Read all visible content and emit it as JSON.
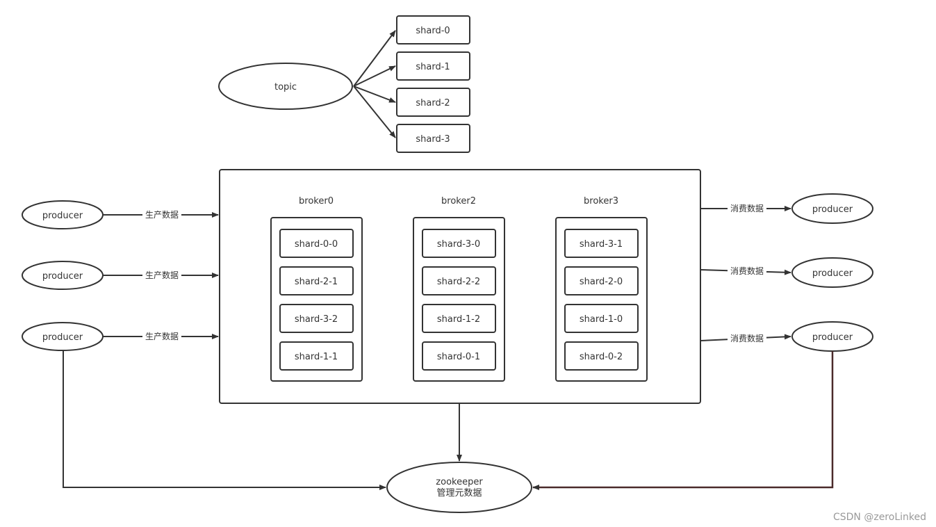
{
  "topic": {
    "label": "topic",
    "shards": [
      "shard-0",
      "shard-1",
      "shard-2",
      "shard-3"
    ]
  },
  "brokers": [
    {
      "name": "broker0",
      "shards": [
        "shard-0-0",
        "shard-2-1",
        "shard-3-2",
        "shard-1-1"
      ]
    },
    {
      "name": "broker2",
      "shards": [
        "shard-3-0",
        "shard-2-2",
        "shard-1-2",
        "shard-0-1"
      ]
    },
    {
      "name": "broker3",
      "shards": [
        "shard-3-1",
        "shard-2-0",
        "shard-1-0",
        "shard-0-2"
      ]
    }
  ],
  "left_producers": [
    {
      "label": "producer",
      "edge": "生产数据"
    },
    {
      "label": "producer",
      "edge": "生产数据"
    },
    {
      "label": "producer",
      "edge": "生产数据"
    }
  ],
  "right_producers": [
    {
      "label": "producer",
      "edge": "消费数据"
    },
    {
      "label": "producer",
      "edge": "消费数据"
    },
    {
      "label": "producer",
      "edge": "消费数据"
    }
  ],
  "zookeeper": {
    "line1": "zookeeper",
    "line2": "管理元数据"
  },
  "watermark": "CSDN @zeroLinked",
  "colors": {
    "stroke": "#333333",
    "highlight_edge": "#4a2a2a"
  }
}
